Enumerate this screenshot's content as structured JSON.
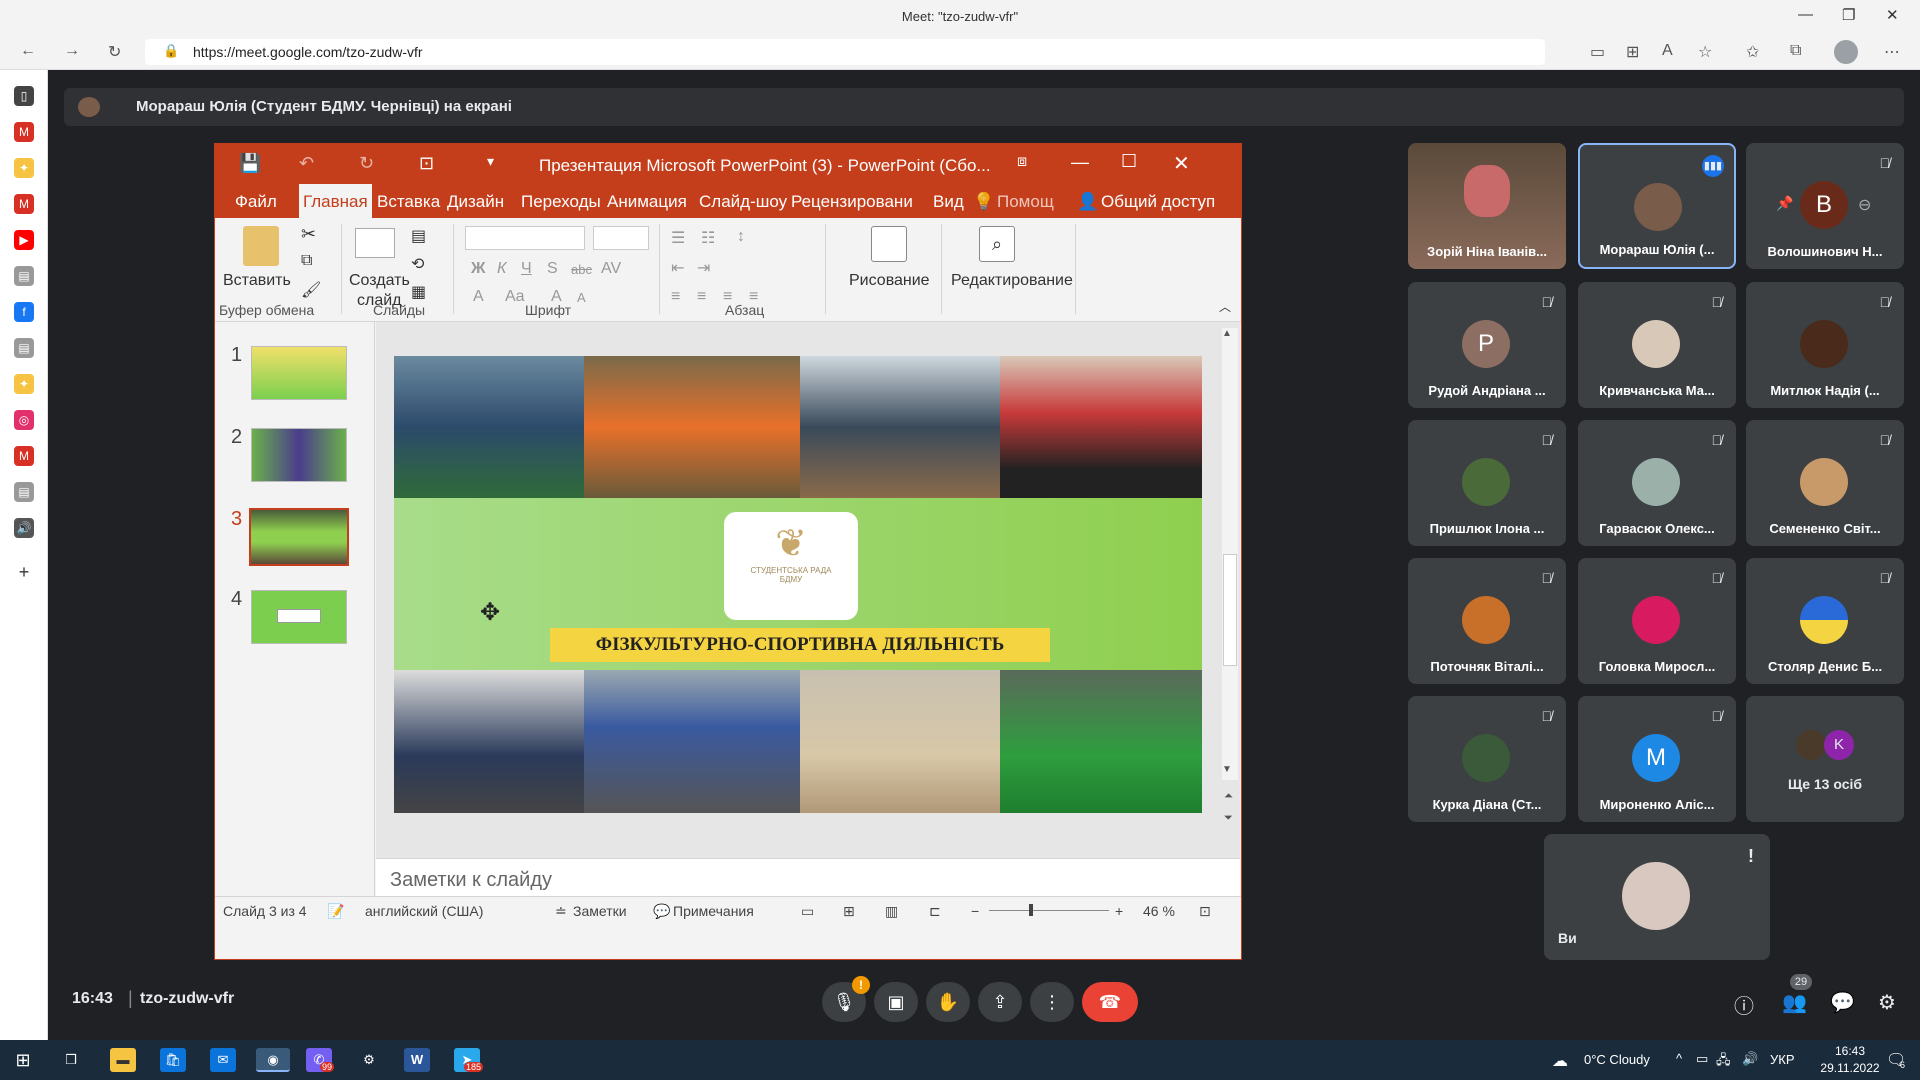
{
  "browser": {
    "window_title": "Meet: \"tzo-zudw-vfr\"",
    "url": "https://meet.google.com/tzo-zudw-vfr"
  },
  "meet": {
    "presenting_banner": "Морараш Юлія (Студент БДМУ. Чернівці) на екрані",
    "time": "16:43",
    "meeting_code": "tzo-zudw-vfr",
    "participants_badge": "29",
    "mic_alert": "!",
    "participants": [
      {
        "name": "Зорій Ніна Іванів...",
        "avatar": "photo"
      },
      {
        "name": "Морараш Юлія (...",
        "avatar": "photo",
        "speaking": true
      },
      {
        "name": "Волошинович Н...",
        "avatar": "В"
      },
      {
        "name": "Рудой Андріана ...",
        "avatar": "P"
      },
      {
        "name": "Кривчанська Ма...",
        "avatar": "photo"
      },
      {
        "name": "Митлюк Надія (...",
        "avatar": "photo"
      },
      {
        "name": "Пришлюк Ілона ...",
        "avatar": "photo"
      },
      {
        "name": "Гарвасюк Олекс...",
        "avatar": "photo"
      },
      {
        "name": "Семененко Світ...",
        "avatar": "photo"
      },
      {
        "name": "Поточняк Віталі...",
        "avatar": "photo"
      },
      {
        "name": "Головка Миросл...",
        "avatar": "photo"
      },
      {
        "name": "Столяр Денис Б...",
        "avatar": "photo"
      },
      {
        "name": "Курка Діана (Ст...",
        "avatar": "photo"
      },
      {
        "name": "Мироненко Аліс...",
        "avatar": "M"
      }
    ],
    "more_tile": {
      "label": "Ще 13 осіб",
      "avatar": "K"
    },
    "self_tile": {
      "label": "Ви",
      "alert": "!"
    }
  },
  "ppt": {
    "title": "Презентация Microsoft PowerPoint (3) - PowerPoint (Сбо...",
    "menu": [
      "Файл",
      "Главная",
      "Вставка",
      "Дизайн",
      "Переходы",
      "Анимация",
      "Слайд-шоу",
      "Рецензировани",
      "Вид",
      "Помощ",
      "Общий доступ"
    ],
    "ribbon": {
      "paste": "Вставить",
      "create_slide_1": "Создать",
      "create_slide_2": "слайд",
      "drawing": "Рисование",
      "editing": "Редактирование",
      "groups": [
        "Буфер обмена",
        "Слайды",
        "Шрифт",
        "Абзац"
      ],
      "font_buttons": [
        "Ж",
        "К",
        "Ч",
        "S",
        "abc",
        "AV",
        "A",
        "Aa",
        "A",
        "A"
      ]
    },
    "thumb_numbers": [
      "1",
      "2",
      "3",
      "4"
    ],
    "slide": {
      "banner": "ФІЗКУЛЬТУРНО-СПОРТИВНА ДІЯЛЬНІСТЬ",
      "logo_line1": "СТУДЕНТСЬКА РАДА",
      "logo_line2": "БДМУ"
    },
    "notes_placeholder": "Заметки к слайду",
    "status": {
      "slide": "Слайд 3 из 4",
      "language": "английский (США)",
      "notes": "Заметки",
      "comments": "Примечания",
      "zoom": "46 %"
    }
  },
  "taskbar": {
    "weather": "0°C  Cloudy",
    "lang": "УКР",
    "time": "16:43",
    "date": "29.11.2022",
    "notif": "6",
    "telegram_badge": "185",
    "viber_badge": "99"
  },
  "colors": {
    "ppt_accent": "#c43e1c",
    "meet_bg": "#202124",
    "tile_bg": "#3c4043",
    "end_call": "#ea4335",
    "slide_green": "#8fcf4f",
    "banner_yellow": "#f5d442"
  }
}
